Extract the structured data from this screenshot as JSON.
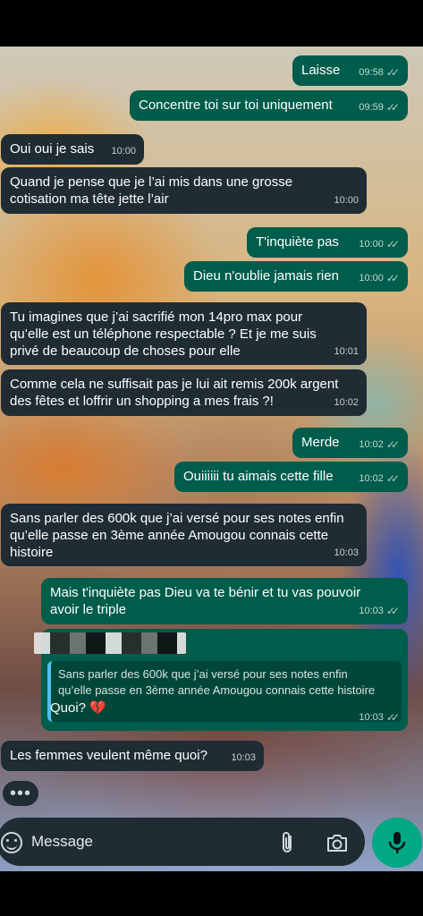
{
  "messages": [
    {
      "dir": "out",
      "text": "Laisse",
      "time": "09:58"
    },
    {
      "dir": "out",
      "text": "Concentre toi sur toi uniquement",
      "time": "09:59"
    },
    {
      "dir": "in",
      "text": "Oui oui je sais",
      "time": "10:00"
    },
    {
      "dir": "in",
      "lines": [
        "Quand je pense que je l’ai mis dans une grosse",
        "cotisation ma tête jette l’air"
      ],
      "time": "10:00"
    },
    {
      "dir": "out",
      "text": "T'inquiète pas",
      "time": "10:00"
    },
    {
      "dir": "out",
      "text": "Dieu n'oublie jamais rien",
      "time": "10:00"
    },
    {
      "dir": "in",
      "lines": [
        "Tu imagines que j’ai sacrifié mon 14pro max pour",
        "qu’elle est un téléphone respectable ? Et je me suis",
        "privé de beaucoup de choses pour elle"
      ],
      "time": "10:01"
    },
    {
      "dir": "in",
      "lines": [
        "Comme cela ne suffisait pas je lui ait remis 200k argent",
        "des fêtes et loffrir un shopping a mes frais ?!"
      ],
      "time": "10:02"
    },
    {
      "dir": "out",
      "text": "Merde",
      "time": "10:02"
    },
    {
      "dir": "out",
      "text": "Ouiiiiii tu aimais cette fille",
      "time": "10:02"
    },
    {
      "dir": "in",
      "lines": [
        "Sans parler des 600k que j’ai versé pour ses notes enfin",
        "qu’elle passe en 3ème année Amougou connais cette",
        "histoire"
      ],
      "time": "10:03"
    },
    {
      "dir": "out",
      "lines": [
        "Mais t'inquiète pas Dieu va te bénir et tu vas pouvoir",
        "avoir le triple"
      ],
      "time": "10:03"
    },
    {
      "dir": "out",
      "quote": [
        "Sans parler des 600k que j’ai versé pour ses notes enfin",
        "qu’elle passe en 3ème année Amougou connais cette histoire"
      ],
      "text": "Quoi? 💔",
      "time": "10:03"
    },
    {
      "dir": "in",
      "text": "Les femmes veulent même quoi?",
      "time": "10:03"
    }
  ],
  "typing_indicator": "•••",
  "composer": {
    "placeholder": "Message"
  },
  "icons": {
    "emoji": "emoji-icon",
    "attach": "paperclip-icon",
    "camera": "camera-icon",
    "mic": "microphone-icon"
  },
  "colors": {
    "outgoing": "#005c4b",
    "incoming": "#1f2c34",
    "accent": "#00a884"
  }
}
